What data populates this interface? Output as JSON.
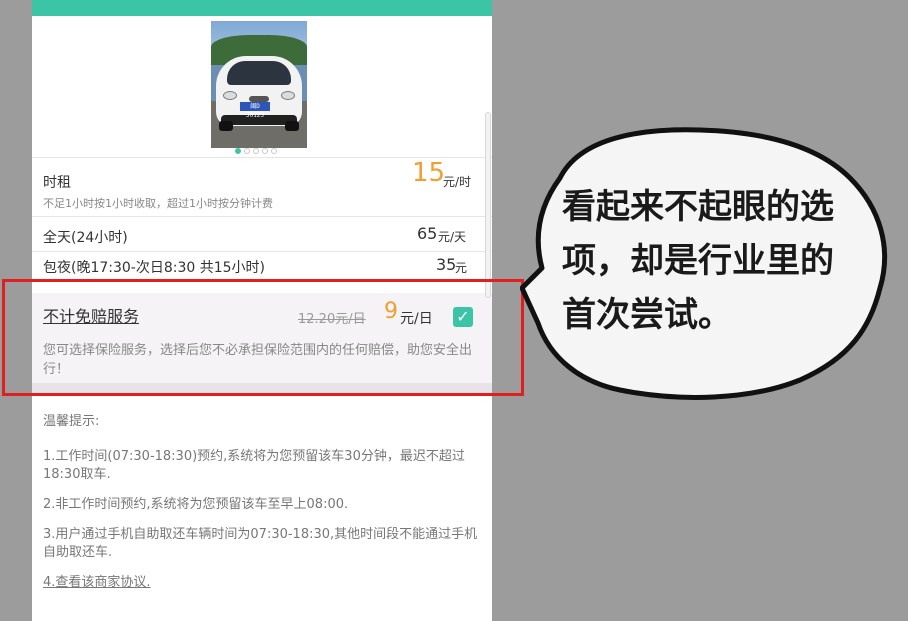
{
  "photo": {
    "plate_text": "闽D J0123"
  },
  "hourly": {
    "title": "时租",
    "price": "15",
    "unit": "元/时",
    "note": "不足1小时按1小时收取，超过1小时按分钟计费"
  },
  "fullday": {
    "title": "全天(24小时)",
    "price": "65",
    "unit": "元/天"
  },
  "overnight": {
    "title": "包夜(晚17:30-次日8:30 共15小时)",
    "price": "35",
    "unit": "元"
  },
  "insurance": {
    "title": "不计免赔服务",
    "old_price": "12.20元/日",
    "price": "9",
    "unit": "元/日",
    "checked": true,
    "description": "您可选择保险服务，选择后您不必承担保险范围内的任何赔偿，助您安全出行！"
  },
  "tips": {
    "title": "温馨提示:",
    "items": [
      "1.工作时间(07:30-18:30)预约,系统将为您预留该车30分钟，最迟不超过18:30取车.",
      "2.非工作时间预约,系统将为您预留该车至早上08:00.",
      "3.用户通过手机自助取还车辆时间为07:30-18:30,其他时间段不能通过手机自助取还车."
    ],
    "link": "4.查看该商家协议."
  },
  "callout": {
    "text": "看起来不起眼的选项，却是行业里的首次尝试。"
  },
  "colors": {
    "accent": "#3cc4a6",
    "price": "#f0a030",
    "highlight": "#e02020"
  }
}
